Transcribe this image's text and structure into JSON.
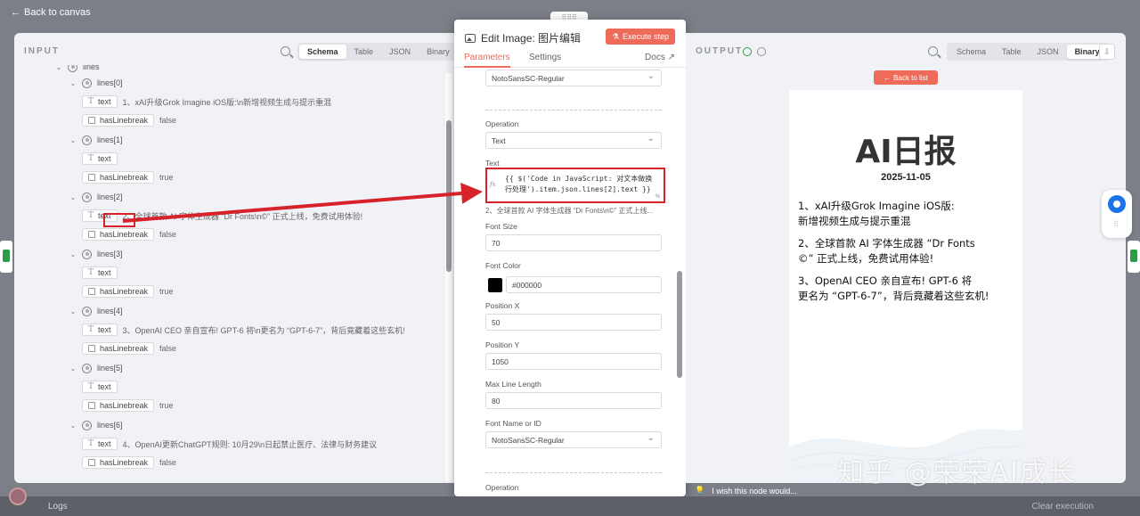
{
  "nav": {
    "back_to_canvas": "Back to canvas"
  },
  "input": {
    "label": "INPUT",
    "tabs": [
      "Schema",
      "Table",
      "JSON",
      "Binary"
    ],
    "active_tab": "Schema",
    "tree_top": "lines",
    "items": [
      {
        "name": "lines[0]",
        "text": "1、xAI升级Grok Imagine iOS版:\\n新增视频生成与提示重混",
        "hasLinebreak": "false"
      },
      {
        "name": "lines[1]",
        "text": "",
        "hasLinebreak": "true"
      },
      {
        "name": "lines[2]",
        "text": "2、全球首款 AI 字体生成器 “Dr Fonts\\n©” 正式上线，免费试用体验!",
        "hasLinebreak": "false"
      },
      {
        "name": "lines[3]",
        "text": "",
        "hasLinebreak": "true"
      },
      {
        "name": "lines[4]",
        "text": "3、OpenAI CEO 亲自宣布! GPT-6 将\\n更名为 “GPT-6-7”，背后竟藏着这些玄机!",
        "hasLinebreak": "false"
      },
      {
        "name": "lines[5]",
        "text": "",
        "hasLinebreak": "true"
      },
      {
        "name": "lines[6]",
        "text": "4、OpenAI更新ChatGPT规则: 10月29\\n日起禁止医疗、法律与财务建议",
        "hasLinebreak": "false"
      }
    ],
    "key_text": "text",
    "key_haslinebreak": "hasLinebreak"
  },
  "modal": {
    "handle": "⠿⠿⠿",
    "title": "Edit Image: 图片编辑",
    "execute_label": "Execute step",
    "tabs": {
      "parameters": "Parameters",
      "settings": "Settings",
      "docs": "Docs"
    },
    "fields": {
      "top_font": "NotoSansSC-Regular",
      "operation_label": "Operation",
      "operation_value": "Text",
      "text_label": "Text",
      "text_expression": "{{ $('Code in JavaScript: 对文本做换行处理').item.json.lines[2].text }}",
      "text_fx": "fx",
      "text_pct": "%",
      "text_result": "2、全球首款 AI 字体生成器 “Dr Fonts\\n©” 正式上线...",
      "font_size_label": "Font Size",
      "font_size_value": "70",
      "font_color_label": "Font Color",
      "font_color_value": "#000000",
      "pos_x_label": "Position X",
      "pos_x_value": "50",
      "pos_y_label": "Position Y",
      "pos_y_value": "1050",
      "max_line_label": "Max Line Length",
      "max_line_value": "80",
      "font_name_label": "Font Name or ID",
      "font_name_value": "NotoSansSC-Regular",
      "operation2_label": "Operation"
    }
  },
  "output": {
    "label": "OUTPUT",
    "tabs": [
      "Schema",
      "Table",
      "JSON",
      "Binary"
    ],
    "active_tab": "Binary",
    "back_to_list": "Back to list",
    "image": {
      "title": "AI日报",
      "date": "2025-11-05",
      "lines": [
        "1、xAI升级Grok Imagine iOS版:\n新增视频生成与提示重混",
        "2、全球首款 AI 字体生成器 “Dr Fonts\n©” 正式上线，免费试用体验!",
        "3、OpenAI CEO 亲自宣布! GPT-6 将\n更名为 “GPT-6-7”，背后竟藏着这些玄机!"
      ]
    }
  },
  "footer": {
    "wish": "I wish this node would...",
    "logs": "Logs",
    "clear_execution": "Clear execution",
    "watermark": "知乎 @荣荣AI成长"
  },
  "colors": {
    "accent": "#ee6b5a",
    "highlight_red": "#d6232b",
    "success": "#2e9b49",
    "chat_blue": "#1a73e8"
  }
}
